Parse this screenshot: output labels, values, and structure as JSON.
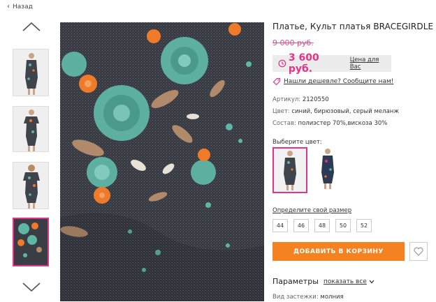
{
  "nav": {
    "back_label": "Назад"
  },
  "product": {
    "title": "Платье, Культ платья BRACEGIRDLE",
    "old_price": "9 000 руб.",
    "price": "3 600 руб.",
    "price_label": "Цена для Вас",
    "cheaper_link": "Нашли дешевле? Сообщите нам!",
    "specs": [
      {
        "label": "Артикул:",
        "value": "2120550"
      },
      {
        "label": "Цвет:",
        "value": "синий, бирюзовый, серый меланж"
      },
      {
        "label": "Состав:",
        "value": "полиэстер 70%,вискоза 30%"
      }
    ],
    "color_label": "Выберите цвет:",
    "size_label": "Определите свой размер",
    "sizes": [
      "44",
      "46",
      "48",
      "50",
      "52"
    ],
    "add_to_cart": "ДОБАВИТЬ В КОРЗИНУ",
    "params_title": "Параметры",
    "show_all": "показать все",
    "clasp_label": "Вид застежки:",
    "clasp_value": "молния"
  },
  "colors": {
    "accent": "#e4338a",
    "cart": "#f58220",
    "fabric": "#3a3d44",
    "floral_teal": "#5fb6a4",
    "floral_orange": "#ef7a2a"
  },
  "icons": [
    "chevron-left-icon",
    "arrow-up-icon",
    "arrow-down-icon",
    "clock-icon",
    "tag-icon",
    "heart-icon",
    "chevron-down-icon"
  ]
}
